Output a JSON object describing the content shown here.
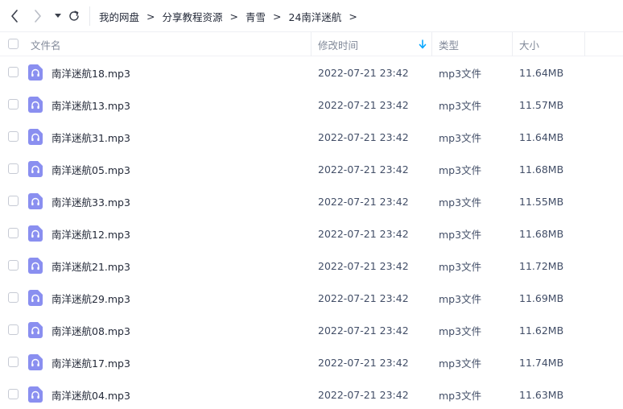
{
  "toolbar": {
    "back_icon": "chevron-left-icon",
    "forward_icon": "chevron-right-icon",
    "history_icon": "caret-down-icon",
    "refresh_icon": "refresh-icon"
  },
  "breadcrumb": {
    "items": [
      "我的网盘",
      "分享教程资源",
      "青雪",
      "24南洋迷航"
    ],
    "separator": ">"
  },
  "table": {
    "columns": {
      "name": "文件名",
      "modified": "修改时间",
      "type": "类型",
      "size": "大小"
    },
    "sort_icon": "arrow-down-icon",
    "rows": [
      {
        "name": "南洋迷航18.mp3",
        "modified": "2022-07-21 23:42",
        "type": "mp3文件",
        "size": "11.64MB"
      },
      {
        "name": "南洋迷航13.mp3",
        "modified": "2022-07-21 23:42",
        "type": "mp3文件",
        "size": "11.57MB"
      },
      {
        "name": "南洋迷航31.mp3",
        "modified": "2022-07-21 23:42",
        "type": "mp3文件",
        "size": "11.64MB"
      },
      {
        "name": "南洋迷航05.mp3",
        "modified": "2022-07-21 23:42",
        "type": "mp3文件",
        "size": "11.68MB"
      },
      {
        "name": "南洋迷航33.mp3",
        "modified": "2022-07-21 23:42",
        "type": "mp3文件",
        "size": "11.55MB"
      },
      {
        "name": "南洋迷航12.mp3",
        "modified": "2022-07-21 23:42",
        "type": "mp3文件",
        "size": "11.68MB"
      },
      {
        "name": "南洋迷航21.mp3",
        "modified": "2022-07-21 23:42",
        "type": "mp3文件",
        "size": "11.72MB"
      },
      {
        "name": "南洋迷航29.mp3",
        "modified": "2022-07-21 23:42",
        "type": "mp3文件",
        "size": "11.69MB"
      },
      {
        "name": "南洋迷航08.mp3",
        "modified": "2022-07-21 23:42",
        "type": "mp3文件",
        "size": "11.62MB"
      },
      {
        "name": "南洋迷航17.mp3",
        "modified": "2022-07-21 23:42",
        "type": "mp3文件",
        "size": "11.74MB"
      },
      {
        "name": "南洋迷航04.mp3",
        "modified": "2022-07-21 23:42",
        "type": "mp3文件",
        "size": "11.63MB"
      }
    ]
  },
  "colors": {
    "audio_icon": "#8a8ff0",
    "accent": "#06a7ff"
  }
}
